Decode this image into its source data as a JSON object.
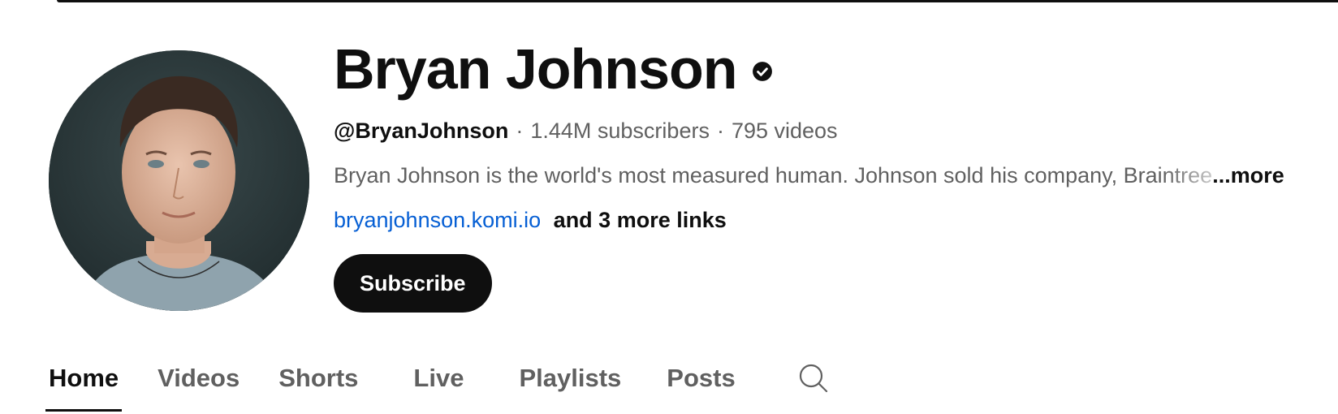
{
  "channel": {
    "name": "Bryan Johnson",
    "handle": "@BryanJohnson",
    "subscribers": "1.44M subscribers",
    "videos": "795 videos",
    "separator": "·",
    "description": "Bryan Johnson is the world's most measured human. Johnson sold his company, Braintree",
    "more_label": "...more",
    "primary_link": "bryanjohnson.komi.io",
    "more_links_label": "and 3 more links",
    "subscribe_label": "Subscribe"
  },
  "tabs": [
    {
      "label": "Home",
      "active": true
    },
    {
      "label": "Videos",
      "active": false
    },
    {
      "label": "Shorts",
      "active": false
    },
    {
      "label": "Live",
      "active": false
    },
    {
      "label": "Playlists",
      "active": false
    },
    {
      "label": "Posts",
      "active": false
    }
  ],
  "icons": {
    "verified": "verified-check-icon",
    "search": "search-icon"
  },
  "colors": {
    "link": "#065fd4",
    "text_primary": "#0f0f0f",
    "text_secondary": "#606060",
    "button_bg": "#0f0f0f"
  }
}
